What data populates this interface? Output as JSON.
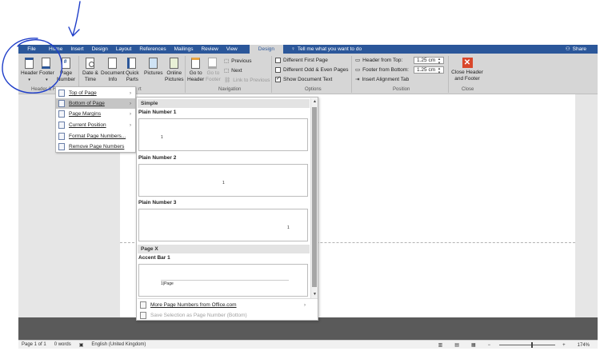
{
  "tabs": {
    "file": "File",
    "home": "Home",
    "insert": "Insert",
    "design": "Design",
    "layout": "Layout",
    "references": "References",
    "mailings": "Mailings",
    "review": "Review",
    "view": "View",
    "context_design": "Design",
    "tell_me": "Tell me what you want to do",
    "share": "Share"
  },
  "ribbon": {
    "header_label": "Header",
    "footer_label": "Footer",
    "page_number_label_1": "Page",
    "page_number_label_2": "Number",
    "date_time_1": "Date &",
    "date_time_2": "Time",
    "doc_info_1": "Document",
    "doc_info_2": "Info",
    "quick_parts_1": "Quick",
    "quick_parts_2": "Parts",
    "pictures": "Pictures",
    "online_pictures_1": "Online",
    "online_pictures_2": "Pictures",
    "goto_header_1": "Go to",
    "goto_header_2": "Header",
    "goto_footer_1": "Go to",
    "goto_footer_2": "Footer",
    "previous": "Previous",
    "next": "Next",
    "link_previous": "Link to Previous",
    "diff_first": "Different First Page",
    "diff_odd_even": "Different Odd & Even Pages",
    "show_doc_text": "Show Document Text",
    "header_from_top": "Header from Top:",
    "footer_from_bottom": "Footer from Bottom:",
    "header_from_top_value": "1.25 cm",
    "footer_from_bottom_value": "1.25 cm",
    "insert_alignment_tab": "Insert Alignment Tab",
    "close_1": "Close Header",
    "close_2": "and Footer",
    "group_header_footer": "Header & F",
    "group_insert_tail": "rt",
    "group_navigation": "Navigation",
    "group_options": "Options",
    "group_position": "Position",
    "group_close": "Close"
  },
  "checkboxes": {
    "diff_first": false,
    "diff_odd_even": false,
    "show_doc_text": true
  },
  "page_number_menu": {
    "items": [
      {
        "label": "Top of Page",
        "submenu": true,
        "highlighted": false
      },
      {
        "label": "Bottom of Page",
        "submenu": true,
        "highlighted": true
      },
      {
        "label": "Page Margins",
        "submenu": true,
        "highlighted": false
      },
      {
        "label": "Current Position",
        "submenu": true,
        "highlighted": false
      },
      {
        "label": "Format Page Numbers...",
        "submenu": false,
        "highlighted": false
      },
      {
        "label": "Remove Page Numbers",
        "submenu": false,
        "highlighted": false
      }
    ]
  },
  "gallery": {
    "section_simple": "Simple",
    "section_page_x": "Page X",
    "plain1": "Plain Number 1",
    "plain2": "Plain Number 2",
    "plain3": "Plain Number 3",
    "accent1": "Accent Bar 1",
    "sample_number": "1",
    "accent_sample": "1|Page",
    "more": "More Page Numbers from Office.com",
    "save_selection": "Save Selection as Page Number (Bottom)"
  },
  "status": {
    "page": "Page 1 of 1",
    "words": "0 words",
    "language": "English (United Kingdom)",
    "zoom_minus": "−",
    "zoom_plus": "+",
    "zoom": "174%"
  },
  "colors": {
    "tab_blue": "#2b579a",
    "ribbon_grey": "#d6d6d6",
    "annotation_ink": "#1f3ec9",
    "close_red": "#d9472b"
  }
}
